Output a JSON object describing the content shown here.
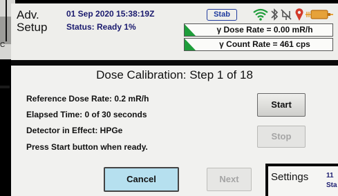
{
  "background": {
    "fragment_text": "C"
  },
  "header": {
    "app_title": "Adv. Setup",
    "datetime": "01 Sep 2020 15:38:19Z",
    "status": "Status: Ready 1%",
    "stab_badge": "Stab",
    "dose_rate": "γ Dose Rate = 0.00 mR/h",
    "count_rate": "γ Count Rate = 461 cps",
    "icons": [
      "wifi-icon",
      "bluetooth-icon",
      "usb-disabled-icon",
      "gps-pin-icon",
      "battery-charging-icon"
    ],
    "colors": {
      "wifi": "#1e9d3a",
      "gps": "#d23a2a",
      "battery": "#e6a23a",
      "rate_indicator": "#1e9d3a"
    }
  },
  "main": {
    "title": "Dose Calibration: Step 1 of 18",
    "reference_dose_rate": "Reference Dose Rate: 0.2 mR/h",
    "elapsed_time": "Elapsed Time: 0 of 30 seconds",
    "detector": "Detector in Effect: HPGe",
    "instruction": "Press Start button when ready.",
    "start_label": "Start",
    "stop_label": "Stop",
    "cancel_label": "Cancel",
    "next_label": "Next"
  },
  "overlay_window": {
    "title": "Settings",
    "date": "11",
    "status": "Sta"
  }
}
